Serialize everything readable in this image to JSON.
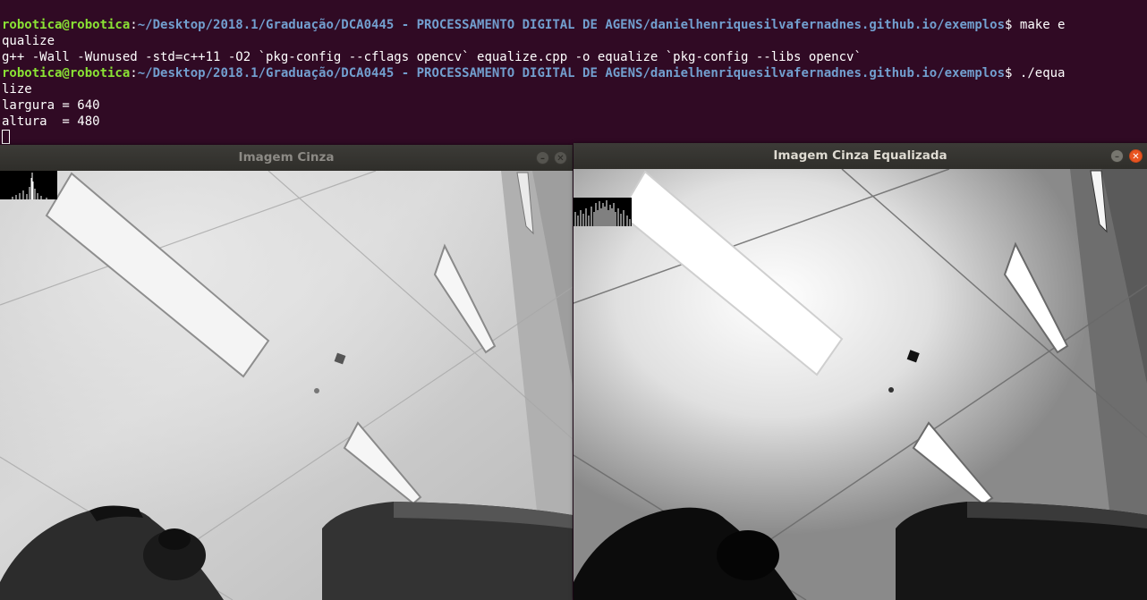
{
  "terminal": {
    "lines": [
      {
        "user": "robotica@robotica",
        "sep": ":",
        "path": "~/Desktop/2018.1/Graduação/DCA0445 - PROCESSAMENTO DIGITAL DE AGENS/danielhenriquesilvafernadnes.github.io/exemplos",
        "cmd": "$ make e"
      },
      {
        "text": "qualize"
      },
      {
        "text": "g++ -Wall -Wunused -std=c++11 -O2 `pkg-config --cflags opencv` equalize.cpp -o equalize `pkg-config --libs opencv`"
      },
      {
        "user": "robotica@robotica",
        "sep": ":",
        "path": "~/Desktop/2018.1/Graduação/DCA0445 - PROCESSAMENTO DIGITAL DE AGENS/danielhenriquesilvafernadnes.github.io/exemplos",
        "cmd": "$ ./equa"
      },
      {
        "text": "lize"
      },
      {
        "text": "largura = 640"
      },
      {
        "text": "altura  = 480"
      }
    ]
  },
  "windows": {
    "left": {
      "title": "Imagem Cinza",
      "close_icon": "close-icon",
      "min_icon": "minimize-icon"
    },
    "right": {
      "title": "Imagem Cinza Equalizada",
      "close_icon": "close-icon",
      "min_icon": "minimize-icon"
    }
  },
  "colors": {
    "terminal_bg": "#300a24",
    "prompt_user": "#8ae234",
    "prompt_path": "#729fcf",
    "close_active": "#e95420"
  }
}
